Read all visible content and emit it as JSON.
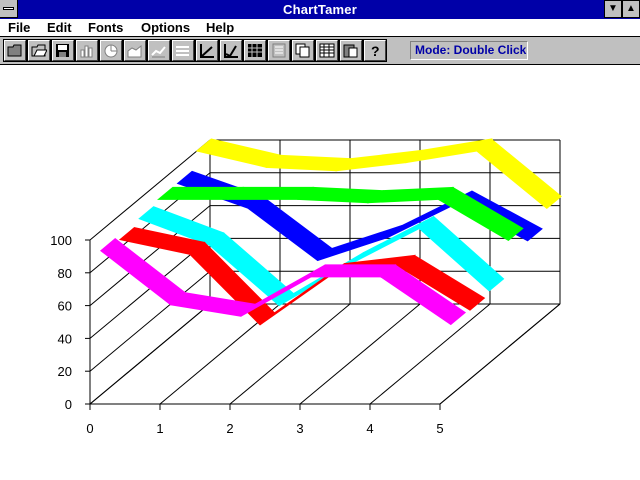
{
  "window": {
    "title": "ChartTamer"
  },
  "menu": {
    "items": [
      {
        "label": "File"
      },
      {
        "label": "Edit"
      },
      {
        "label": "Fonts"
      },
      {
        "label": "Options"
      },
      {
        "label": "Help"
      }
    ]
  },
  "toolbar": {
    "buttons": [
      {
        "icon": "open-folder-icon"
      },
      {
        "icon": "open-file-icon"
      },
      {
        "icon": "save-icon"
      },
      {
        "icon": "bar-chart-icon"
      },
      {
        "icon": "pie-chart-icon"
      },
      {
        "icon": "area-chart-icon"
      },
      {
        "icon": "line-chart-icon"
      },
      {
        "icon": "ribbon-chart-icon"
      },
      {
        "icon": "axes-icon"
      },
      {
        "icon": "axes-alt-icon"
      },
      {
        "icon": "data-sheet-icon"
      },
      {
        "icon": "notes-icon"
      },
      {
        "icon": "copy-icon"
      },
      {
        "icon": "grid-icon"
      },
      {
        "icon": "paste-icon"
      },
      {
        "icon": "help-icon"
      }
    ],
    "mode": "Mode: Double Click"
  },
  "colors": {
    "title_bar": "#0000a8",
    "series": [
      "#0000ff",
      "#00ff00",
      "#ffff00",
      "#ff0000",
      "#00ffff",
      "#ff00ff"
    ]
  },
  "chart_data": {
    "type": "line",
    "style": "3d-ribbon",
    "x": [
      0,
      1,
      2,
      3,
      4,
      5
    ],
    "ylim": [
      0,
      100
    ],
    "y_ticks": [
      "0",
      "20",
      "40",
      "60",
      "80",
      "100"
    ],
    "x_ticks": [
      "0",
      "1",
      "2",
      "3",
      "4",
      "5"
    ],
    "grid": true,
    "legend": "none",
    "series": [
      {
        "color": "#0000ff",
        "values": [
          90,
          75,
          43,
          57,
          78,
          55
        ]
      },
      {
        "color": "#00ff00",
        "values": [
          90,
          90,
          90,
          88,
          90,
          65
        ]
      },
      {
        "color": "#ffff00",
        "values": [
          100,
          90,
          88,
          93,
          100,
          65
        ]
      },
      {
        "color": "#ff0000",
        "values": [
          85,
          76,
          33,
          63,
          68,
          42
        ]
      },
      {
        "color": "#00ffff",
        "values": [
          88,
          72,
          35,
          60,
          82,
          44
        ]
      },
      {
        "color": "#ff00ff",
        "values": [
          88,
          55,
          48,
          72,
          72,
          43
        ]
      }
    ]
  }
}
